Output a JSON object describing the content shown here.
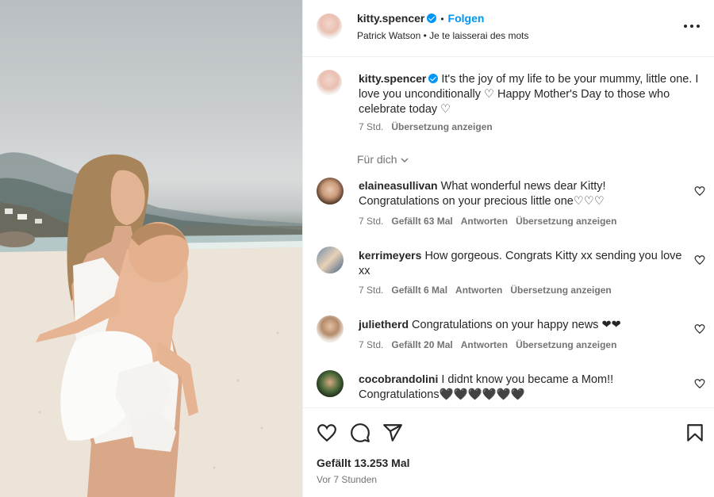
{
  "post": {
    "username": "kitty.spencer",
    "follow_label": "Folgen",
    "separator": "•",
    "audio": "Patrick Watson • Je te laisserai des mots",
    "more_icon": "more-horizontal-icon"
  },
  "caption": {
    "username": "kitty.spencer",
    "text": "It's the joy of my life to be your mummy, little one. I love you unconditionally ♡ Happy Mother's Day to those who celebrate today ♡",
    "time": "7 Std.",
    "translate_label": "Übersetzung anzeigen"
  },
  "filter": {
    "label": "Für dich"
  },
  "comments": [
    {
      "username": "elaineasullivan",
      "text": "What wonderful news dear Kitty! Congratulations on your precious little one♡♡♡",
      "time": "7 Std.",
      "likes": "Gefällt 63 Mal",
      "reply": "Antworten",
      "translate": "Übersetzung anzeigen"
    },
    {
      "username": "kerrimeyers",
      "text": "How gorgeous. Congrats Kitty xx sending you love xx",
      "time": "7 Std.",
      "likes": "Gefällt 6 Mal",
      "reply": "Antworten",
      "translate": "Übersetzung anzeigen"
    },
    {
      "username": "julietherd",
      "text": "Congratulations on your happy news ❤❤",
      "time": "7 Std.",
      "likes": "Gefällt 20 Mal",
      "reply": "Antworten",
      "translate": "Übersetzung anzeigen"
    },
    {
      "username": "cocobrandolini",
      "text": "I didnt know you became a Mom!! Congratulations🖤🖤🖤🖤🖤🖤",
      "time": "",
      "likes": "",
      "reply": "",
      "translate": ""
    }
  ],
  "footer": {
    "likes": "Gefällt 13.253 Mal",
    "posted": "Vor 7 Stunden"
  },
  "colors": {
    "accent": "#0095f6",
    "text": "#262626",
    "muted": "#737373",
    "heart_red": "#e0245e"
  }
}
